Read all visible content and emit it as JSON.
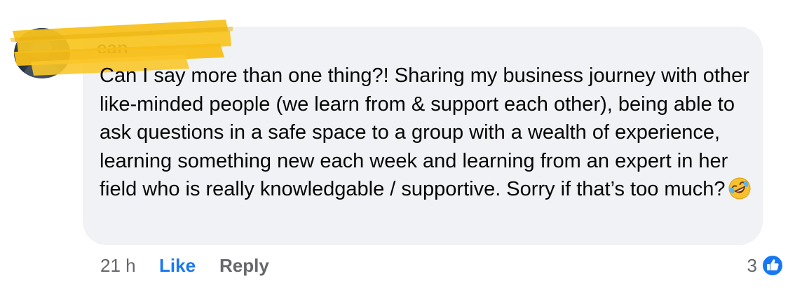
{
  "comment": {
    "author": "ean",
    "text": "Can I say more than one thing?! Sharing my business journey with other like-minded people (we learn from & support each other), being able to ask questions in a safe space to a group with a wealth of experience, learning something new each week and learning from an expert in her field who is really knowledgable / supportive. Sorry if that’s too much?",
    "emoji": "rolling-on-the-floor-laughing-icon"
  },
  "footer": {
    "time": "21 h",
    "like_label": "Like",
    "reply_label": "Reply",
    "reaction_count": "3",
    "reaction_icon": "thumbs-up-icon"
  },
  "colors": {
    "bubble": "#f0f2f5",
    "like_blue": "#1877f2",
    "meta_gray": "#65676b",
    "redaction_yellow": "#f7c21d"
  }
}
